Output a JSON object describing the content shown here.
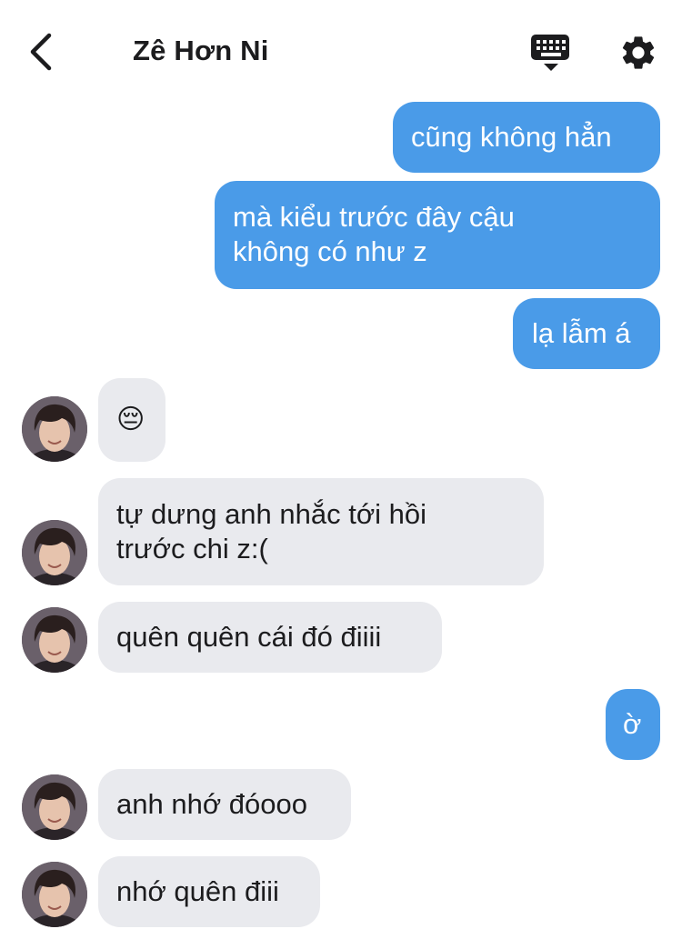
{
  "header": {
    "title": "Zê Hơn Ni",
    "back_icon": "chevron-left-icon",
    "keyboard_icon": "keyboard-icon",
    "settings_icon": "gear-icon"
  },
  "colors": {
    "sent_bubble": "#4a9be8",
    "received_bubble": "#e9eaee",
    "text_dark": "#1c1c1e"
  },
  "messages": [
    {
      "sender": "me",
      "lines": [
        "cũng không hẳn"
      ]
    },
    {
      "sender": "me",
      "lines": [
        "mà kiểu trước đây cậu",
        "không có như z"
      ]
    },
    {
      "sender": "me",
      "lines": [
        "lạ lẫm á"
      ]
    },
    {
      "sender": "contact",
      "lines": [
        "😔"
      ]
    },
    {
      "sender": "contact",
      "lines": [
        "tự dưng anh nhắc tới hồi",
        "trước chi z:("
      ]
    },
    {
      "sender": "contact",
      "lines": [
        "quên quên cái đó điiii"
      ]
    },
    {
      "sender": "me",
      "lines": [
        "ờ"
      ]
    },
    {
      "sender": "contact",
      "lines": [
        "anh nhớ đóooo"
      ]
    },
    {
      "sender": "contact",
      "lines": [
        "nhớ quên điii"
      ]
    }
  ]
}
